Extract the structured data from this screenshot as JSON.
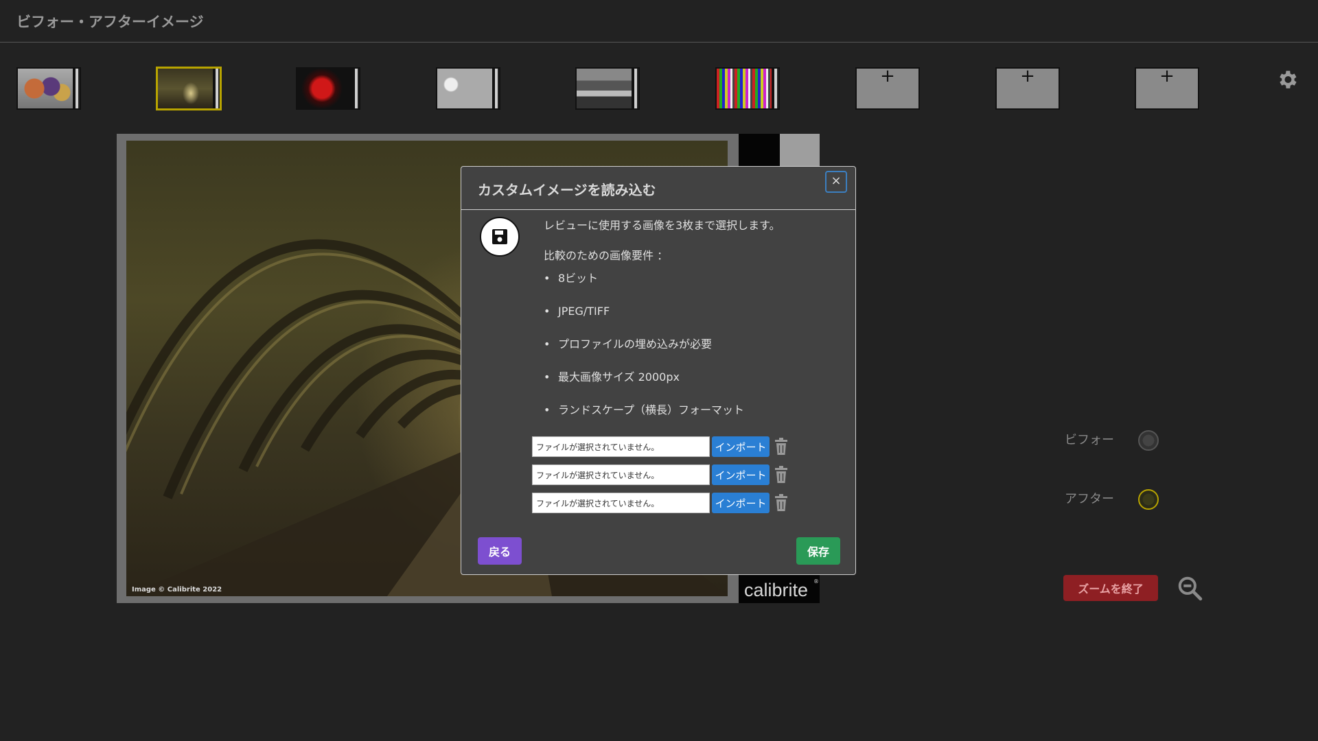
{
  "app": {
    "title": "ビフォー・アフターイメージ"
  },
  "thumbnails": [
    {
      "kind": "image",
      "icon": "people-photo-thumbnail",
      "selected": false
    },
    {
      "kind": "image",
      "icon": "abbey-arches-thumbnail",
      "selected": true
    },
    {
      "kind": "image",
      "icon": "red-flower-thumbnail",
      "selected": false
    },
    {
      "kind": "image",
      "icon": "white-texture-thumbnail",
      "selected": false
    },
    {
      "kind": "image",
      "icon": "landscape-bw-thumbnail",
      "selected": false
    },
    {
      "kind": "image",
      "icon": "color-bars-thumbnail",
      "selected": false
    },
    {
      "kind": "empty",
      "label": "+"
    },
    {
      "kind": "empty",
      "label": "+"
    },
    {
      "kind": "empty",
      "label": "+"
    }
  ],
  "viewer": {
    "credit": "Image © Calibrite 2022",
    "logo": "calibrite",
    "logo_mark": "®"
  },
  "controls": {
    "before_label": "ビフォー",
    "after_label": "アフター",
    "exit_zoom_label": "ズームを終了",
    "accent_color": "#b8a400"
  },
  "modal": {
    "title": "カスタムイメージを読み込む",
    "close_label": "×",
    "intro": "レビューに使用する画像を3枚まで選択します。",
    "requirements_title": "比較のための画像要件 ：",
    "requirements": [
      "8ビット",
      "JPEG/TIFF",
      "プロファイルの埋め込みが必要",
      "最大画像サイズ 2000px",
      "ランドスケープ（横長）フォーマット"
    ],
    "file_rows": [
      {
        "placeholder": "ファイルが選択されていません。",
        "import_label": "インポート"
      },
      {
        "placeholder": "ファイルが選択されていません。",
        "import_label": "インポート"
      },
      {
        "placeholder": "ファイルが選択されていません。",
        "import_label": "インポート"
      }
    ],
    "back_label": "戻る",
    "save_label": "保存"
  }
}
